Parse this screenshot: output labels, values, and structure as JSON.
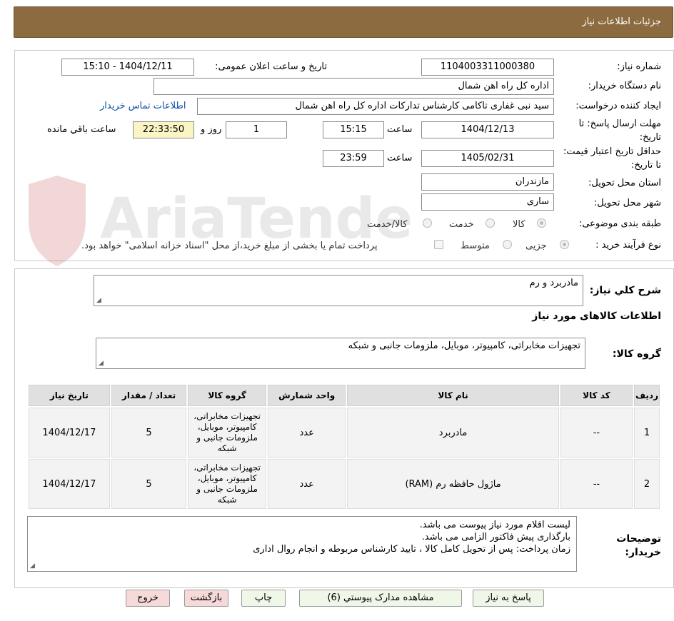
{
  "header": {
    "title": "جزئیات اطلاعات نیاز"
  },
  "form": {
    "need_number_label": "شماره نیاز:",
    "need_number": "1104003311000380",
    "announce_label": "تاریخ و ساعت اعلان عمومی:",
    "announce_value": "1404/12/11 - 15:10",
    "buyer_org_label": "نام دستگاه خریدار:",
    "buyer_org": "اداره کل راه اهن شمال",
    "creator_label": "ایجاد کننده درخواست:",
    "creator": "سید نبی غفاری تاکامی کارشناس تدارکات اداره کل راه اهن شمال",
    "contact_link": "اطلاعات تماس خریدار",
    "deadline_label": "مهلت ارسال پاسخ: تا تاریخ:",
    "deadline_date": "1404/12/13",
    "hour_label": "ساعت",
    "deadline_time": "15:15",
    "days_value": "1",
    "days_label": "روز و",
    "remaining_time": "22:33:50",
    "remaining_label": "ساعت باقي مانده",
    "validity_label": "حداقل تاریخ اعتبار قیمت: تا تاریخ:",
    "validity_date": "1405/02/31",
    "validity_hour_label": "ساعت",
    "validity_time": "23:59",
    "province_label": "استان محل تحویل:",
    "province": "مازندران",
    "city_label": "شهر محل تحویل:",
    "city": "ساری",
    "category_label": "طبقه بندی موضوعی:",
    "category_options": [
      "کالا",
      "خدمت",
      "کالا/خدمت"
    ],
    "process_label": "نوع فرآیند خرید :",
    "process_options": [
      "جزیی",
      "متوسط"
    ],
    "payment_note": "پرداخت تمام یا بخشی از مبلغ خرید،از محل \"اسناد خزانه اسلامی\" خواهد بود."
  },
  "description": {
    "label": "شرح کلي نیاز:",
    "value": "مادربرد و رم",
    "goods_info_title": "اطلاعات کالاهای مورد نیاز",
    "group_label": "گروه کالا:",
    "group_value": "تجهیزات مخابراتی، کامپیوتر، موبایل، ملزومات جانبی و شبکه"
  },
  "table": {
    "headers": [
      "ردیف",
      "کد کالا",
      "نام کالا",
      "واحد شمارش",
      "گروه کالا",
      "تعداد / مقدار",
      "تاریخ نیاز"
    ],
    "rows": [
      {
        "row": "1",
        "code": "--",
        "name": "مادربرد",
        "unit": "عدد",
        "group": "تجهیزات مخابراتی، کامپیوتر، موبایل، ملزومات جانبی و شبکه",
        "qty": "5",
        "date": "1404/12/17"
      },
      {
        "row": "2",
        "code": "--",
        "name": "ماژول حافظه رم (RAM)",
        "unit": "عدد",
        "group": "تجهیزات مخابراتی، کامپیوتر، موبایل، ملزومات جانبی و شبکه",
        "qty": "5",
        "date": "1404/12/17"
      }
    ]
  },
  "notes": {
    "label_line1": "توضیحات",
    "label_line2": "خریدار:",
    "lines": [
      "لیست اقلام مورد نیاز پیوست می باشد.",
      "بارگذاری پیش فاکتور الزامی می باشد.",
      "زمان پرداخت: پس از تحویل کامل کالا ، تایید کارشناس مربوطه و انجام روال اداری"
    ]
  },
  "buttons": {
    "reply": "پاسخ به نیاز",
    "attachments": "مشاهده مدارک پیوستي (6)",
    "print": "چاپ",
    "back": "بازگشت",
    "exit": "خروج"
  },
  "watermark": {
    "text": "AriaTender.net"
  }
}
